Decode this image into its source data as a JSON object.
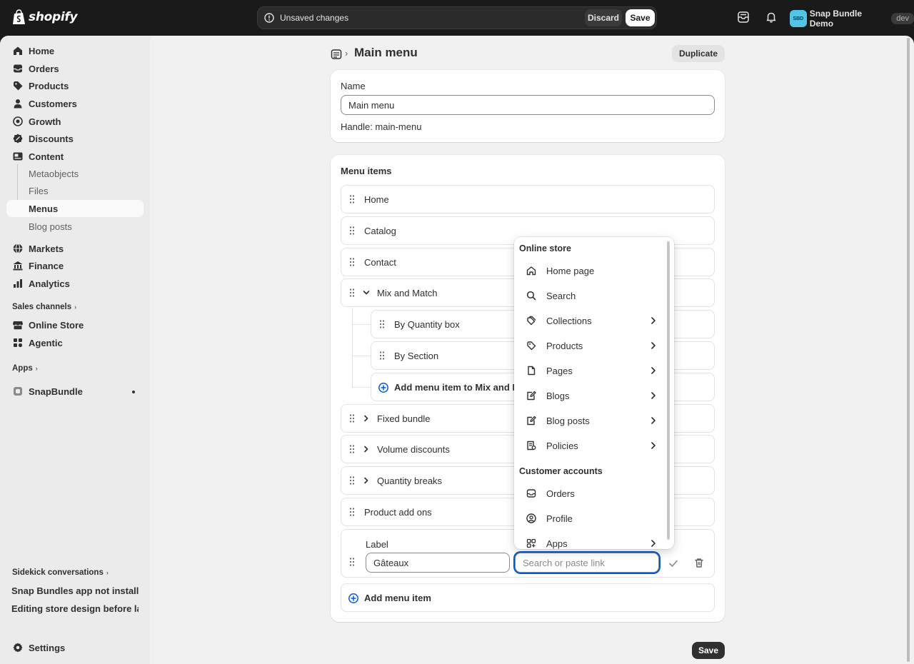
{
  "brand": {
    "logo_text": "shopify"
  },
  "topbar": {
    "unsaved_text": "Unsaved changes",
    "discard_label": "Discard",
    "save_label": "Save",
    "store_avatar": "SBD",
    "store_name": "Snap Bundle Demo",
    "env_badge": "dev"
  },
  "sidebar": {
    "items": [
      {
        "label": "Home",
        "icon": "home-icon"
      },
      {
        "label": "Orders",
        "icon": "inbox-icon"
      },
      {
        "label": "Products",
        "icon": "tag-icon"
      },
      {
        "label": "Customers",
        "icon": "person-icon"
      },
      {
        "label": "Growth",
        "icon": "target-icon"
      },
      {
        "label": "Discounts",
        "icon": "discount-icon"
      },
      {
        "label": "Content",
        "icon": "content-icon"
      }
    ],
    "content_sub": [
      "Metaobjects",
      "Files",
      "Menus",
      "Blog posts"
    ],
    "items2": [
      {
        "label": "Markets",
        "icon": "globe-icon"
      },
      {
        "label": "Finance",
        "icon": "bank-icon"
      },
      {
        "label": "Analytics",
        "icon": "chart-icon"
      }
    ],
    "sales_channels_label": "Sales channels",
    "channels": [
      "Online Store",
      "Agentic"
    ],
    "apps_label": "Apps",
    "apps": [
      "SnapBundle"
    ],
    "sidekick_label": "Sidekick conversations",
    "conversations": [
      "Snap Bundles app not installed",
      "Editing store design before launch"
    ],
    "settings_label": "Settings"
  },
  "page": {
    "title": "Main menu",
    "duplicate_label": "Duplicate",
    "name_label": "Name",
    "name_value": "Main menu",
    "handle_text": "Handle: main-menu",
    "menu_items_title": "Menu items",
    "items": {
      "home": "Home",
      "catalog": "Catalog",
      "contact": "Contact",
      "mix_and_match": "Mix and Match",
      "by_quantity_box": "By Quantity box",
      "by_section": "By Section",
      "add_to_mix": "Add menu item to Mix and Match",
      "fixed_bundle": "Fixed bundle",
      "volume_discounts": "Volume discounts",
      "quantity_breaks": "Quantity breaks",
      "product_add_ons": "Product add ons"
    },
    "edit": {
      "label": "Label",
      "label_value": "Gâteaux",
      "link_placeholder": "Search or paste link"
    },
    "add_menu_item": "Add menu item",
    "bottom_save": "Save"
  },
  "popover": {
    "section1": "Online store",
    "items1": [
      {
        "label": "Home page",
        "icon": "home-icon",
        "has_chevron": false
      },
      {
        "label": "Search",
        "icon": "search-icon",
        "has_chevron": false
      },
      {
        "label": "Collections",
        "icon": "collection-icon",
        "has_chevron": true
      },
      {
        "label": "Products",
        "icon": "tag-icon",
        "has_chevron": true
      },
      {
        "label": "Pages",
        "icon": "page-icon",
        "has_chevron": true
      },
      {
        "label": "Blogs",
        "icon": "blog-icon",
        "has_chevron": true
      },
      {
        "label": "Blog posts",
        "icon": "blog-post-icon",
        "has_chevron": true
      },
      {
        "label": "Policies",
        "icon": "policy-icon",
        "has_chevron": true
      }
    ],
    "section2": "Customer accounts",
    "items2": [
      {
        "label": "Orders",
        "icon": "inbox-icon",
        "has_chevron": false
      },
      {
        "label": "Profile",
        "icon": "profile-icon",
        "has_chevron": false
      },
      {
        "label": "Apps",
        "icon": "apps-icon",
        "has_chevron": true
      }
    ]
  }
}
